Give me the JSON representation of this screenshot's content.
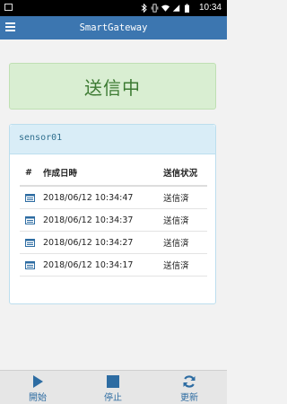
{
  "status_bar": {
    "time": "10:34",
    "icons": [
      "image-icon",
      "bluetooth-icon",
      "vibrate-icon",
      "wifi-icon",
      "signal-icon",
      "battery-icon"
    ]
  },
  "app_bar": {
    "title": "SmartGateway",
    "menu_icon": "hamburger-icon"
  },
  "banner": {
    "text": "送信中",
    "color": "#3c7a32",
    "background": "#d9eed2"
  },
  "panel": {
    "title": "sensor01",
    "table": {
      "headers": [
        "#",
        "作成日時",
        "送信状況"
      ],
      "rows": [
        {
          "created": "2018/06/12 10:34:47",
          "status": "送信済"
        },
        {
          "created": "2018/06/12 10:34:37",
          "status": "送信済"
        },
        {
          "created": "2018/06/12 10:34:27",
          "status": "送信済"
        },
        {
          "created": "2018/06/12 10:34:17",
          "status": "送信済"
        }
      ]
    }
  },
  "toolbar": {
    "start_label": "開始",
    "stop_label": "停止",
    "refresh_label": "更新",
    "accent": "#2d6ca2"
  },
  "colors": {
    "app_bar": "#3c76b0",
    "panel_head": "#d9edf7"
  }
}
